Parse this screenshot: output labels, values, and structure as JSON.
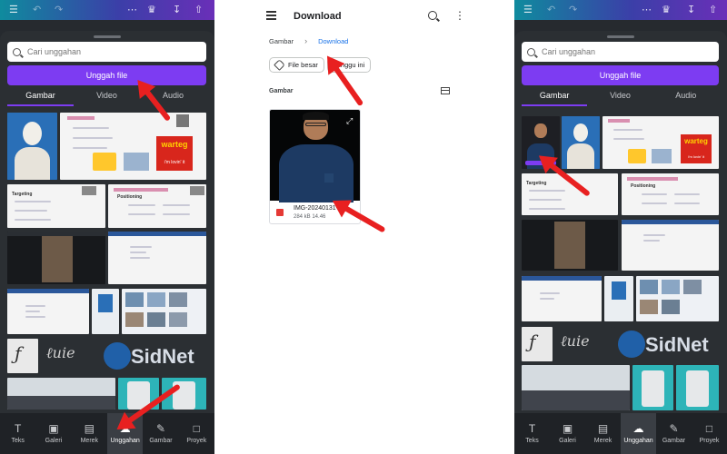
{
  "left_app": {
    "search": {
      "placeholder": "Cari unggahan"
    },
    "upload_button": "Unggah file",
    "tabs": [
      "Gambar",
      "Video",
      "Audio"
    ],
    "bottom_nav": [
      {
        "label": "Teks",
        "icon": "text-icon"
      },
      {
        "label": "Galeri",
        "icon": "camera-icon"
      },
      {
        "label": "Merek",
        "icon": "brand-icon"
      },
      {
        "label": "Unggahan",
        "icon": "upload-cloud-icon",
        "active": true
      },
      {
        "label": "Gambar",
        "icon": "draw-icon"
      },
      {
        "label": "Proyek",
        "icon": "folder-icon"
      }
    ],
    "thumb_texts": {
      "slide_title": "Positioning",
      "slide_title2": "Targeting",
      "ad_text": "warteg",
      "ad_sub": "i'm lovin' it",
      "logo": "SidNet"
    }
  },
  "file_manager": {
    "title": "Download",
    "breadcrumb": [
      "Gambar",
      "Download"
    ],
    "chips": [
      "File besar",
      "Minggu ini"
    ],
    "section_label": "Gambar",
    "file": {
      "name": "IMG-20240131-W",
      "info": "284 kB 14.46"
    }
  },
  "right_app": {
    "search": {
      "placeholder": "Cari unggahan"
    },
    "upload_button": "Unggah file",
    "tabs": [
      "Gambar",
      "Video",
      "Audio"
    ],
    "bottom_nav": [
      {
        "label": "Teks",
        "icon": "text-icon"
      },
      {
        "label": "Galeri",
        "icon": "camera-icon"
      },
      {
        "label": "Merek",
        "icon": "brand-icon"
      },
      {
        "label": "Unggahan",
        "icon": "upload-cloud-icon",
        "active": true
      },
      {
        "label": "Gambar",
        "icon": "draw-icon"
      },
      {
        "label": "Proyek",
        "icon": "folder-icon"
      }
    ],
    "thumb_texts": {
      "slide_title": "Positioning",
      "slide_title2": "Targeting",
      "ad_text": "warteg",
      "ad_sub": "i'm lovin' it",
      "logo": "SidNet"
    }
  },
  "colors": {
    "accent": "#7d3cf2",
    "sheet": "#2b2f33",
    "arrow": "#e82020",
    "link": "#1a73e8"
  }
}
